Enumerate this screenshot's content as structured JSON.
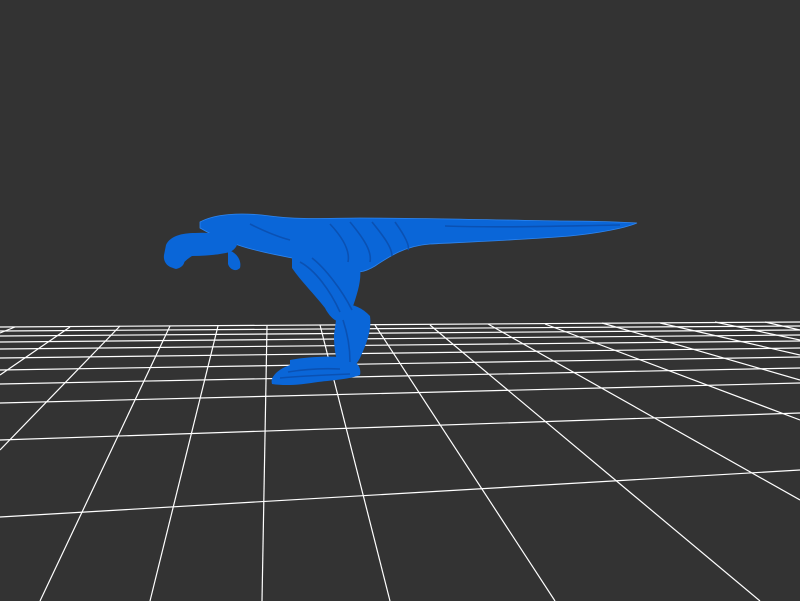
{
  "viewer": {
    "background_color": "#333333",
    "grid_color": "#ffffff",
    "model_color": "#0a66d8",
    "model_shade_color": "#0a4fb0",
    "model_highlight_color": "#2f86f0",
    "model_name": "dinosaur-model"
  }
}
